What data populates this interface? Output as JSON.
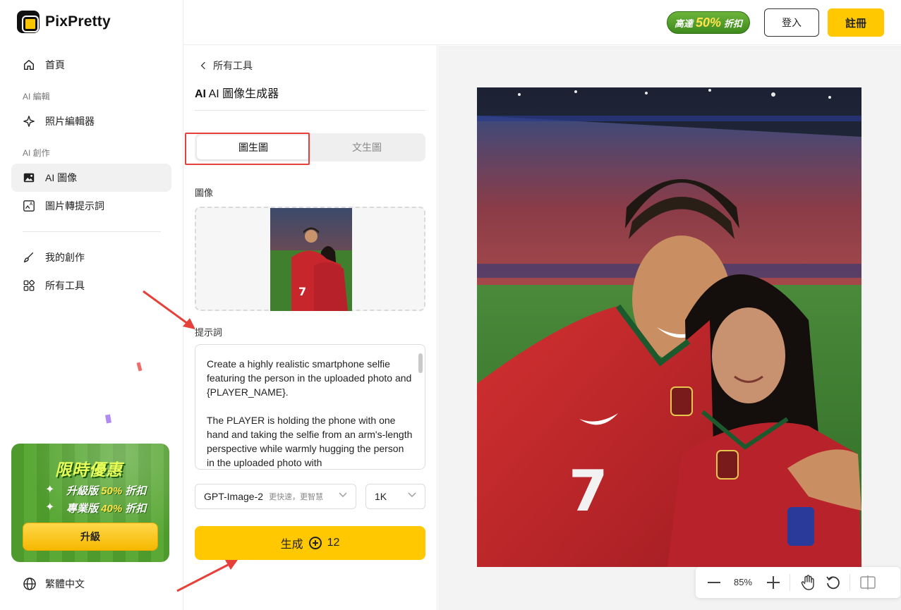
{
  "brand": {
    "name": "PixPretty"
  },
  "sidebar": {
    "home": "首頁",
    "section_edit": "AI 編輯",
    "photo_editor": "照片編輯器",
    "section_create": "AI 創作",
    "ai_image": "AI 圖像",
    "image_to_prompt": "圖片轉提示詞",
    "my_creations": "我的創作",
    "all_tools": "所有工具",
    "language": "繁體中文"
  },
  "promo": {
    "title": "限時優惠",
    "line1_prefix": "升級版 ",
    "line1_pct": "50%",
    "line1_suffix": " 折扣",
    "line2_prefix": "專業版 ",
    "line2_pct": "40%",
    "line2_suffix": " 折扣",
    "button": "升級"
  },
  "header": {
    "badge_prefix": "高達",
    "badge_pct": "50%",
    "badge_suffix": "折扣",
    "login": "登入",
    "signup": "註冊"
  },
  "panel": {
    "back_label": "所有工具",
    "title": "AI 圖像生成器",
    "tab_image_to_image": "圖生圖",
    "tab_text_to_image": "文生圖",
    "image_label": "圖像",
    "prompt_label": "提示詞",
    "prompt_text": "Create a highly realistic smartphone selfie featuring the person in the uploaded photo and {PLAYER_NAME}.\n\nThe PLAYER is holding the phone with one hand and taking the selfie from an arm's-length perspective while warmly hugging the person in the uploaded photo with",
    "model": "GPT-Image-2",
    "model_sub": "更快速，更智慧",
    "resolution": "1K",
    "generate": "生成",
    "credits": "12"
  },
  "zoom": {
    "level": "85%"
  },
  "colors": {
    "accent": "#ffc800",
    "annotation": "#e5413a",
    "promo_green": "#4e9a2c"
  }
}
